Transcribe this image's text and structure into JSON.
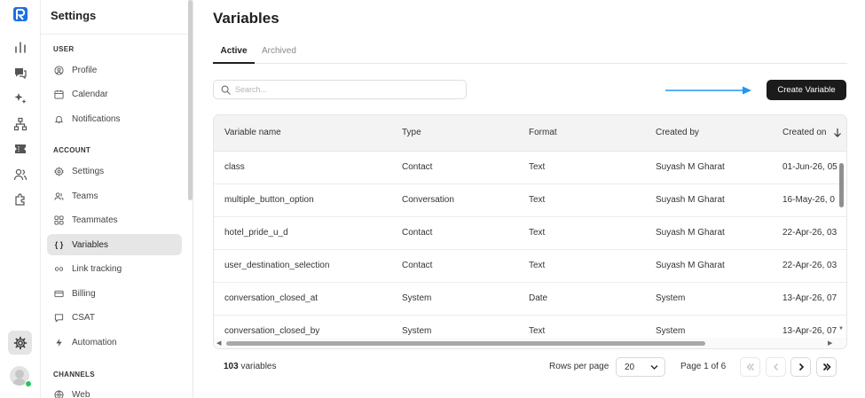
{
  "sidebar": {
    "title": "Settings",
    "sections": {
      "user": "USER",
      "account": "ACCOUNT",
      "channels": "CHANNELS"
    },
    "items": {
      "profile": "Profile",
      "calendar": "Calendar",
      "notifications": "Notifications",
      "settings": "Settings",
      "teams": "Teams",
      "teammates": "Teammates",
      "variables": "Variables",
      "link_tracking": "Link tracking",
      "billing": "Billing",
      "csat": "CSAT",
      "automation": "Automation",
      "web": "Web"
    },
    "active_glyph": "{ }"
  },
  "page": {
    "title": "Variables",
    "tabs": {
      "active": "Active",
      "archived": "Archived"
    },
    "search_placeholder": "Search...",
    "create_button": "Create Variable"
  },
  "table": {
    "columns": {
      "name": "Variable name",
      "type": "Type",
      "format": "Format",
      "created_by": "Created by",
      "created_on": "Created on"
    },
    "rows": [
      {
        "name": "class",
        "type": "Contact",
        "format": "Text",
        "created_by": "Suyash M Gharat",
        "created_on": "01-Jun-26, 05"
      },
      {
        "name": "multiple_button_option",
        "type": "Conversation",
        "format": "Text",
        "created_by": "Suyash M Gharat",
        "created_on": "16-May-26, 0"
      },
      {
        "name": "hotel_pride_u_d",
        "type": "Contact",
        "format": "Text",
        "created_by": "Suyash M Gharat",
        "created_on": "22-Apr-26, 03"
      },
      {
        "name": "user_destination_selection",
        "type": "Contact",
        "format": "Text",
        "created_by": "Suyash M Gharat",
        "created_on": "22-Apr-26, 03"
      },
      {
        "name": "conversation_closed_at",
        "type": "System",
        "format": "Date",
        "created_by": "System",
        "created_on": "13-Apr-26, 07"
      },
      {
        "name": "conversation_closed_by",
        "type": "System",
        "format": "Text",
        "created_by": "System",
        "created_on": "13-Apr-26, 07"
      }
    ]
  },
  "footer": {
    "count_number": "103",
    "count_suffix": " variables",
    "rows_per_page_label": "Rows per page",
    "rows_per_page_value": "20",
    "page_label": "Page 1 of 6"
  },
  "colors": {
    "accent_arrow": "#2196f3",
    "primary_button": "#1b1b1b",
    "online": "#22c55e"
  }
}
